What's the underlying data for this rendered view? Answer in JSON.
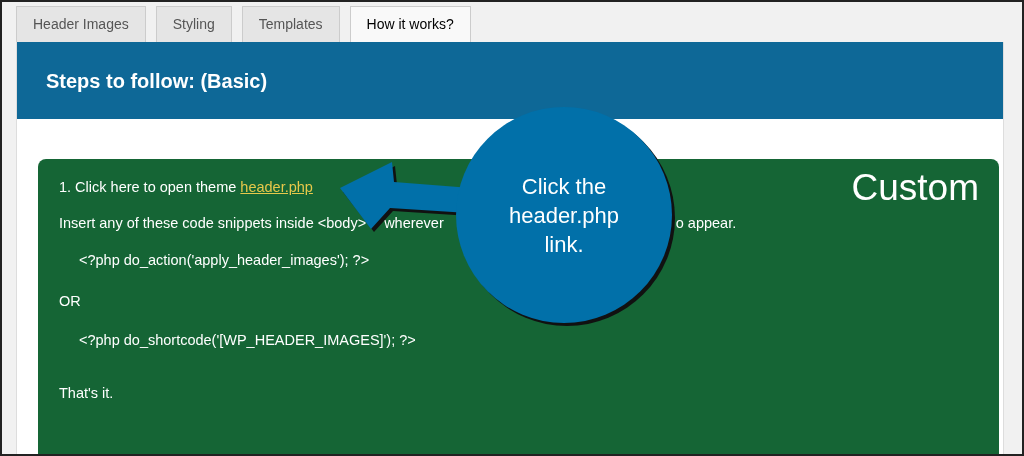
{
  "tabs": [
    {
      "label": "Header Images",
      "selected": false
    },
    {
      "label": "Styling",
      "selected": false
    },
    {
      "label": "Templates",
      "selected": false
    },
    {
      "label": "How it works?",
      "selected": true
    }
  ],
  "header": {
    "title": "Steps to follow: (Basic)"
  },
  "panel": {
    "badge": "Custom",
    "step": {
      "text": "1. Click here to open theme",
      "link": "header.php"
    },
    "instruction_parts": [
      "Insert any of these code snippets inside <body>",
      "wherever",
      "o appear."
    ],
    "snippet_1": "<?php do_action('apply_header_images'); ?>",
    "separator": "OR",
    "snippet_2": "<?php do_shortcode('[WP_HEADER_IMAGES]'); ?>",
    "closing": "That's it."
  },
  "callout": {
    "text": "Click the header.php link."
  }
}
